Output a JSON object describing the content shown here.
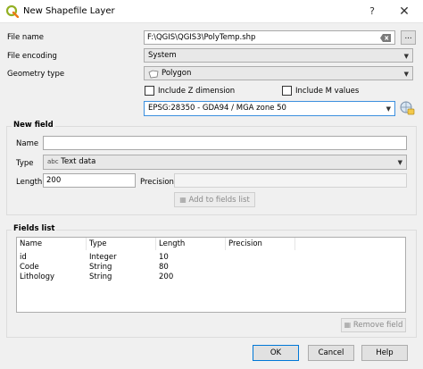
{
  "window": {
    "title": "New Shapefile Layer",
    "help": "?",
    "close": "✕"
  },
  "file_name": {
    "label": "File name",
    "value": "F:\\QGIS\\QGIS3\\PolyTemp.shp",
    "browse_label": "..."
  },
  "file_encoding": {
    "label": "File encoding",
    "value": "System"
  },
  "geometry_type": {
    "label": "Geometry type",
    "value": "Polygon"
  },
  "include_z": {
    "label": "Include Z dimension",
    "checked": false
  },
  "include_m": {
    "label": "Include M values",
    "checked": false
  },
  "crs": {
    "value": "EPSG:28350 - GDA94 / MGA zone 50"
  },
  "new_field": {
    "title": "New field",
    "name_label": "Name",
    "name_value": "",
    "type_label": "Type",
    "type_prefix": "abc",
    "type_value": "Text data",
    "length_label": "Length",
    "length_value": "200",
    "precision_label": "Precision",
    "precision_value": "",
    "add_button": "Add to fields list"
  },
  "fields_list": {
    "title": "Fields list",
    "headers": [
      "Name",
      "Type",
      "Length",
      "Precision"
    ],
    "rows": [
      [
        "id",
        "Integer",
        "10",
        ""
      ],
      [
        "Code",
        "String",
        "80",
        ""
      ],
      [
        "Lithology",
        "String",
        "200",
        ""
      ]
    ],
    "remove_button": "Remove field"
  },
  "buttons": {
    "ok": "OK",
    "cancel": "Cancel",
    "help": "Help"
  }
}
